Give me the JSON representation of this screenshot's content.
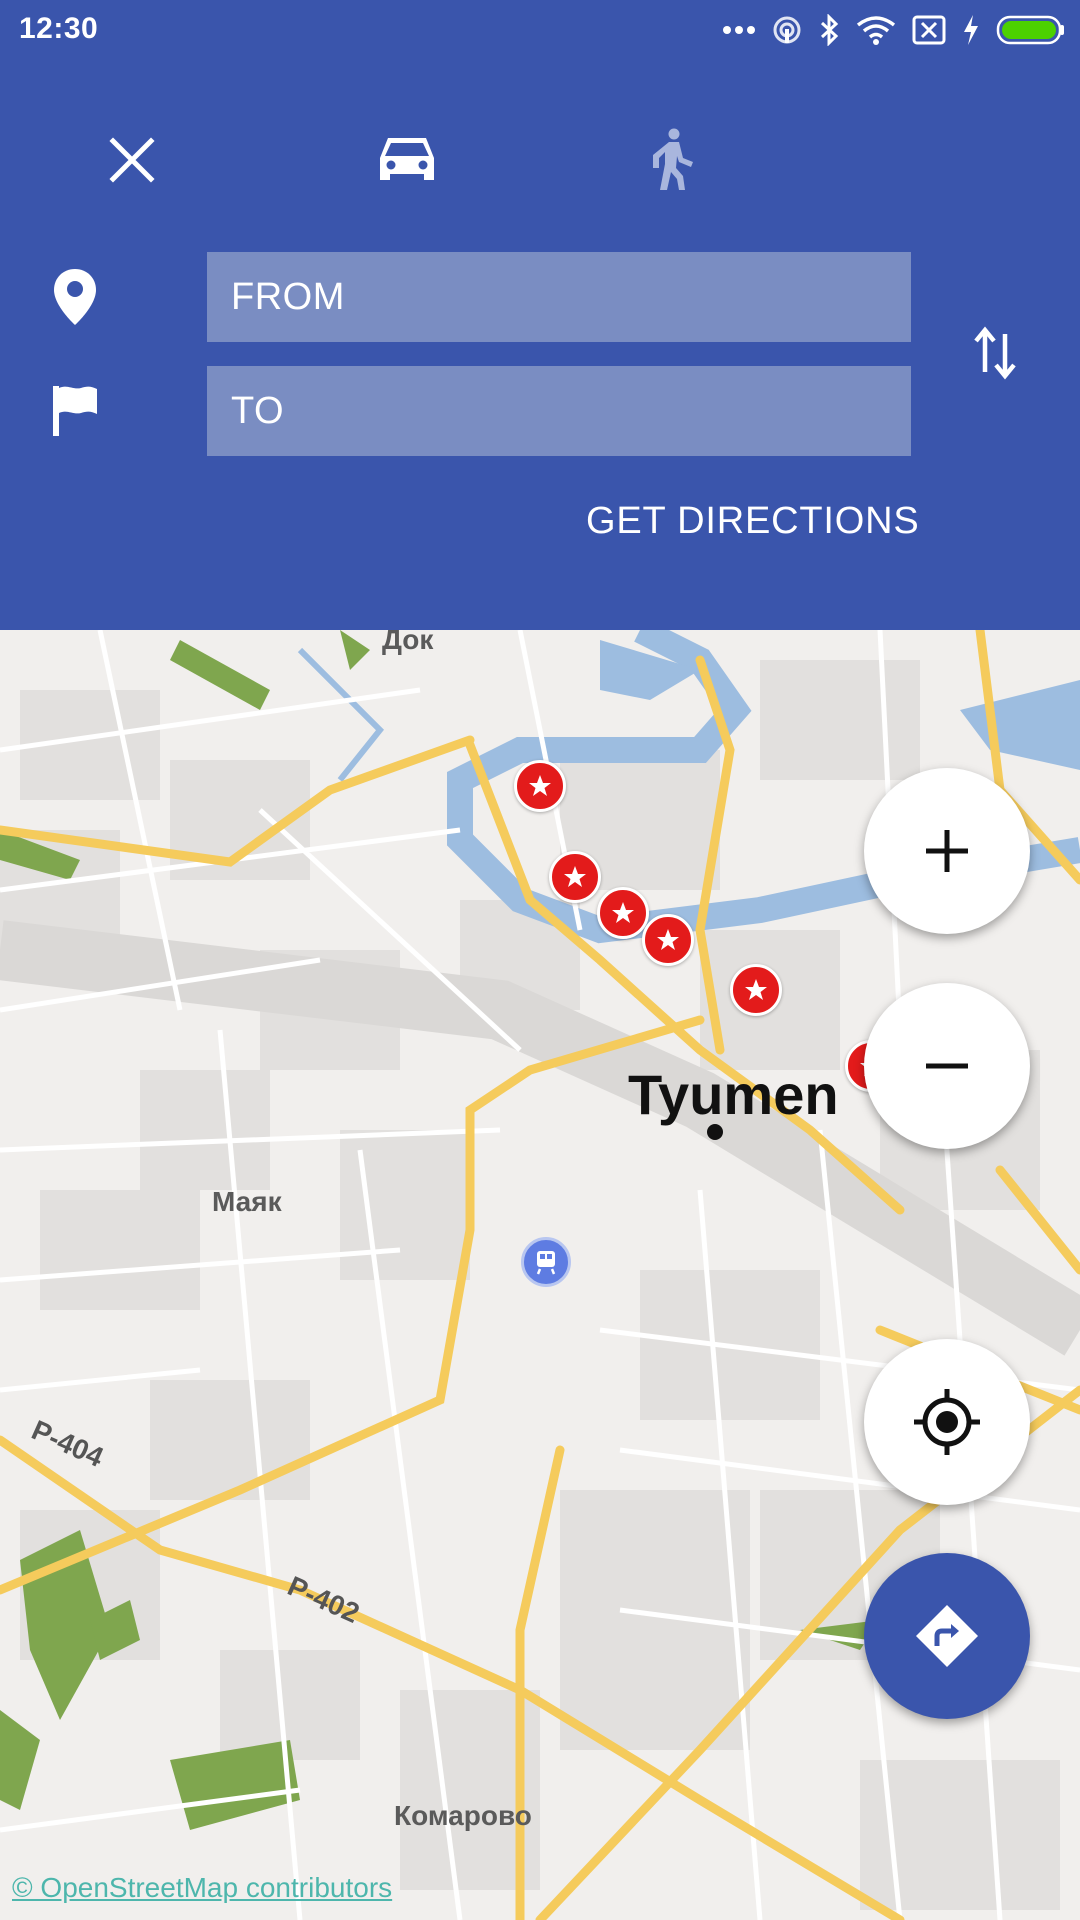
{
  "status_bar": {
    "time": "12:30",
    "icons": [
      "more-icon",
      "hotspot-icon",
      "bluetooth-icon",
      "wifi-icon",
      "no-sim-icon",
      "charging-icon",
      "battery-icon"
    ]
  },
  "modes": {
    "close": "close-icon",
    "car": "car-icon",
    "walk": "walk-icon"
  },
  "inputs": {
    "from_placeholder": "FROM",
    "to_placeholder": "TO"
  },
  "actions": {
    "get_directions": "GET DIRECTIONS"
  },
  "map": {
    "city": "Tyumen",
    "labels": {
      "top": "Док",
      "mayak": "Маяк",
      "komarovo": "Комарово",
      "r404": "P-404",
      "r402": "P-402"
    },
    "credit": "© OpenStreetMap contributors"
  },
  "colors": {
    "header": "#3A55AC",
    "field": "#7A8DC2",
    "marker": "#E31B1B",
    "road": "#F5CB5C",
    "water": "#9DBDE0",
    "green": "#7FA64E",
    "credit": "#4DB6AC"
  }
}
